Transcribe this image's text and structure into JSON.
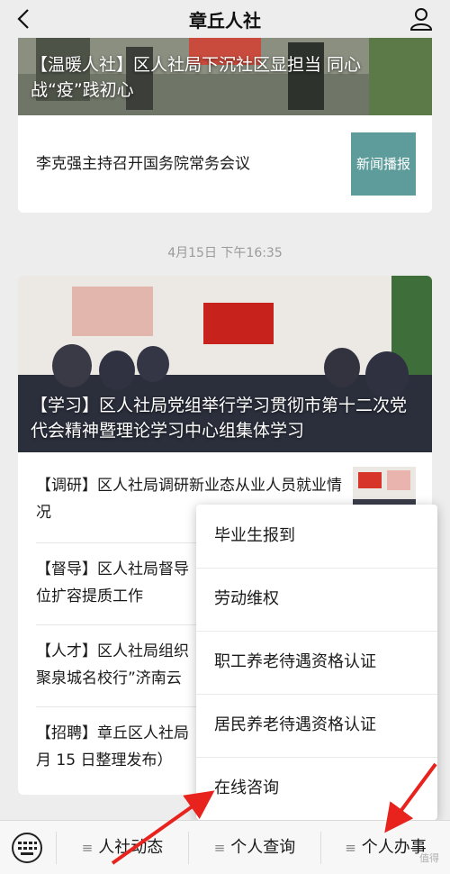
{
  "header": {
    "title": "章丘人社",
    "back_icon": "chevron-left-icon",
    "profile_icon": "user-icon"
  },
  "card1": {
    "headline": "【温暖人社】区人社局下沉社区显担当 同心战“疫”践初心",
    "sub_title": "李克强主持召开国务院常务会议",
    "thumb_label": "新闻播报"
  },
  "timestamp": "4月15日 下午16:35",
  "card2": {
    "headline": "【学习】区人社局党组举行学习贯彻市第十二次党代会精神暨理论学习中心组集体学习",
    "items": [
      {
        "text": "【调研】区人社局调研新业态从业人员就业情况"
      },
      {
        "text": "【督导】区人社局督导"
      },
      {
        "text2": "位扩容提质工作"
      },
      {
        "text": "【人才】区人社局组织"
      },
      {
        "text2": "聚泉城名校行”济南云"
      },
      {
        "text": "【招聘】章丘区人社局"
      },
      {
        "text2": "月 15 日整理发布）"
      }
    ]
  },
  "popup_menu": {
    "items": [
      "毕业生报到",
      "劳动维权",
      "职工养老待遇资格认证",
      "居民养老待遇资格认证",
      "在线咨询"
    ]
  },
  "bottom_menu": {
    "keyboard_icon": "keyboard-icon",
    "items": [
      "人社动态",
      "个人查询",
      "个人办事"
    ]
  },
  "watermark": "值得",
  "colors": {
    "arrow": "#e8231e",
    "thumb_bg": "#5d9c9b"
  }
}
